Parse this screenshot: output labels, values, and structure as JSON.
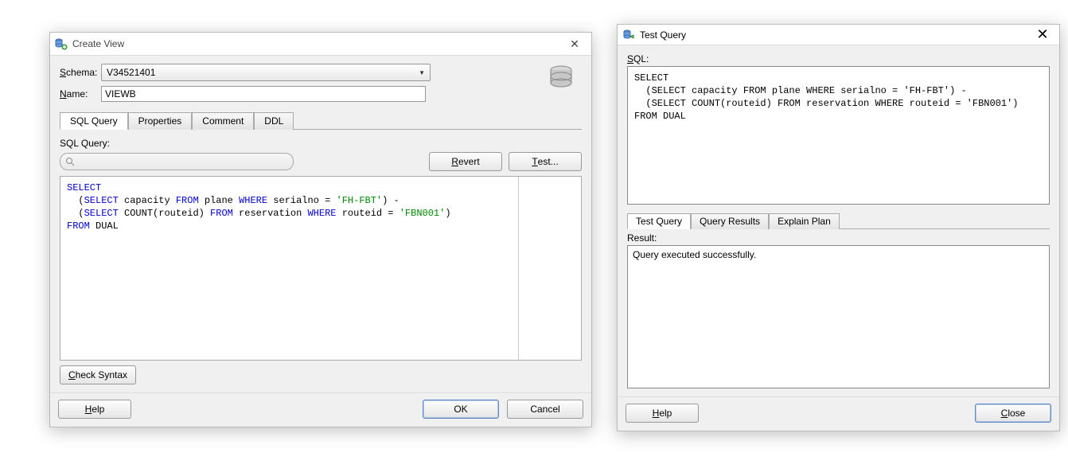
{
  "create_view": {
    "title": "Create View",
    "schema_label_pre": "S",
    "schema_label_rest": "chema:",
    "schema_value": "V34521401",
    "name_label_pre": "N",
    "name_label_rest": "ame:",
    "name_value": "VIEWB",
    "tabs": {
      "sql_query": "SQL Query",
      "properties": "Properties",
      "comment": "Comment",
      "ddl": "DDL"
    },
    "sql_query_label": "SQL Query:",
    "revert_u": "R",
    "revert_rest": "evert",
    "test_u": "T",
    "test_rest": "est...",
    "sql_tokens": {
      "l1_select": "SELECT",
      "l2_open": "  (",
      "l2_select": "SELECT",
      "l2_mid1": " capacity ",
      "l2_from": "FROM",
      "l2_mid2": " plane ",
      "l2_where": "WHERE",
      "l2_mid3": " serialno = ",
      "l2_str": "'FH-FBT'",
      "l2_close": ") -",
      "l3_open": "  (",
      "l3_select": "SELECT",
      "l3_mid1": " COUNT(routeid) ",
      "l3_from": "FROM",
      "l3_mid2": " reservation ",
      "l3_where": "WHERE",
      "l3_mid3": " routeid = ",
      "l3_str": "'FBN001'",
      "l3_close": ")",
      "l4_from": "FROM",
      "l4_rest": " DUAL"
    },
    "check_syntax_u": "C",
    "check_syntax_rest": "heck Syntax",
    "help_u": "H",
    "help_rest": "elp",
    "ok": "OK",
    "cancel": "Cancel"
  },
  "test_query": {
    "title": "Test Query",
    "sql_label": "SQL:",
    "sql_text": "SELECT\n  (SELECT capacity FROM plane WHERE serialno = 'FH-FBT') -\n  (SELECT COUNT(routeid) FROM reservation WHERE routeid = 'FBN001')\nFROM DUAL",
    "tabs": {
      "test_query": "Test Query",
      "query_results": "Query Results",
      "explain_plan": "Explain Plan"
    },
    "result_label_pre": "R",
    "result_label_rest": "esult:",
    "result_text": "Query executed successfully.",
    "help_u": "H",
    "help_rest": "elp",
    "close_u": "C",
    "close_rest": "lose"
  }
}
